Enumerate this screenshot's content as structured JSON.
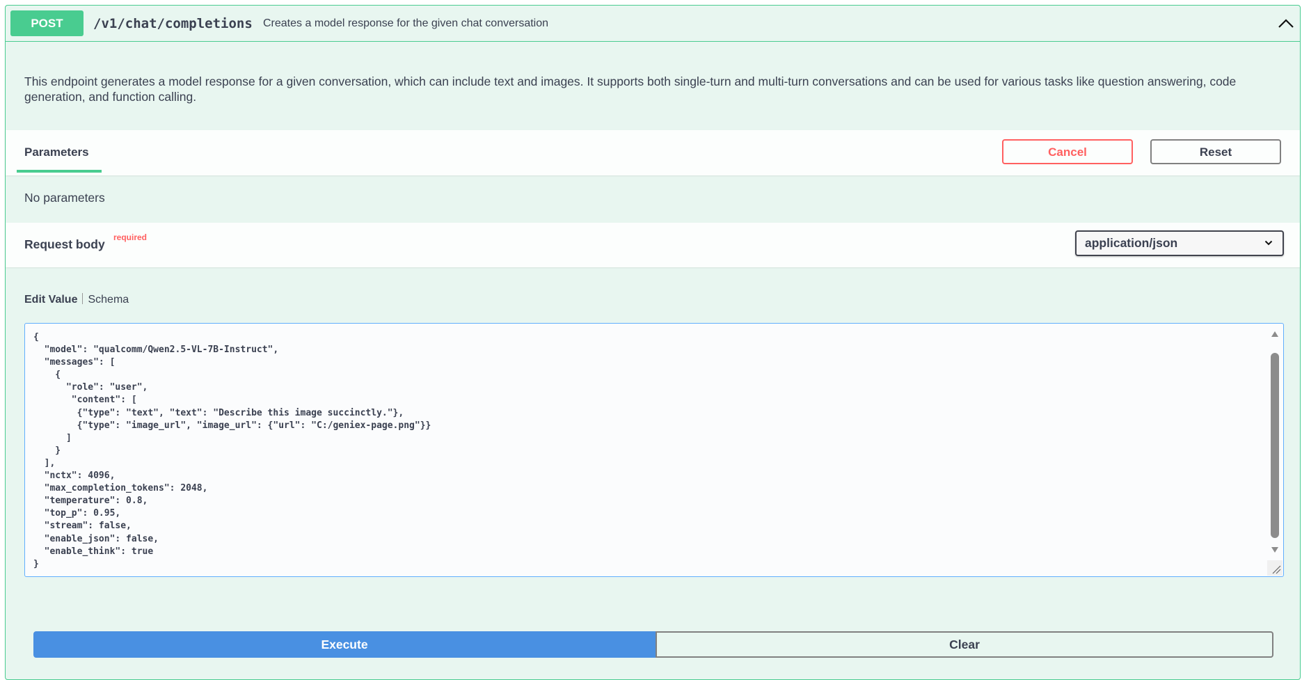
{
  "operation": {
    "method": "POST",
    "path": "/v1/chat/completions",
    "summary": "Creates a model response for the given chat conversation",
    "description": "This endpoint generates a model response for a given conversation, which can include text and images. It supports both single-turn and multi-turn conversations and can be used for various tasks like question answering, code generation, and function calling."
  },
  "parameters": {
    "tab_label": "Parameters",
    "cancel_label": "Cancel",
    "reset_label": "Reset",
    "empty_text": "No parameters"
  },
  "request_body": {
    "title": "Request body",
    "required_label": "required",
    "content_type": "application/json",
    "edit_tab_label": "Edit Value",
    "schema_tab_label": "Schema",
    "editor_value": "{\n  \"model\": \"qualcomm/Qwen2.5-VL-7B-Instruct\",\n  \"messages\": [\n    {\n      \"role\": \"user\",\n       \"content\": [\n        {\"type\": \"text\", \"text\": \"Describe this image succinctly.\"},\n        {\"type\": \"image_url\", \"image_url\": {\"url\": \"C:/geniex-page.png\"}}\n      ]\n    }\n  ],\n  \"nctx\": 4096,\n  \"max_completion_tokens\": 2048,\n  \"temperature\": 0.8,\n  \"top_p\": 0.95,\n  \"stream\": false,\n  \"enable_json\": false,\n  \"enable_think\": true\n}"
  },
  "actions": {
    "execute_label": "Execute",
    "clear_label": "Clear"
  },
  "icons": {
    "collapse": "chevron-up-icon",
    "select": "chevron-down-icon",
    "scroll_up": "triangle-up-icon",
    "scroll_down": "triangle-down-icon",
    "resize": "resize-grip-icon"
  },
  "colors": {
    "post_method": "#49cc90",
    "block_background": "#e8f6f0",
    "cancel": "#ff6060",
    "execute": "#4990e2",
    "editor_focus_border": "#61affe"
  }
}
